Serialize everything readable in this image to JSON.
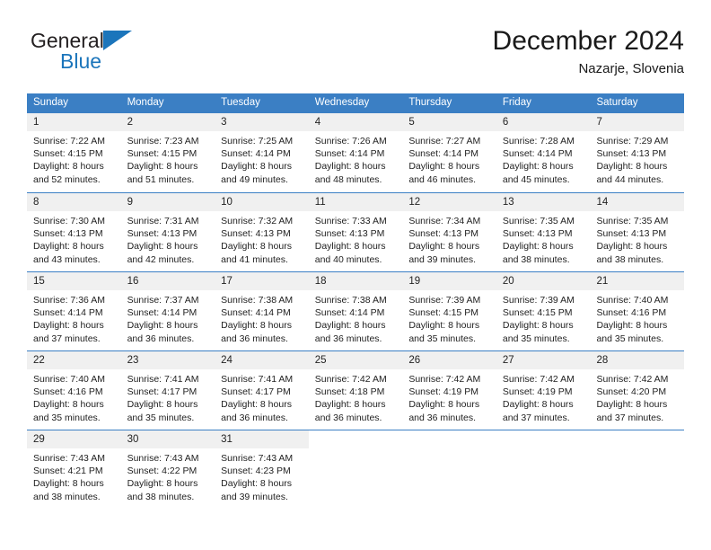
{
  "brand": {
    "name_top": "General",
    "name_bottom": "Blue",
    "triangle_color": "#1b75bb"
  },
  "header": {
    "title": "December 2024",
    "subtitle": "Nazarje, Slovenia"
  },
  "theme": {
    "header_blue": "#3b7fc4",
    "day_band_gray": "#f0f0f0",
    "text": "#222222"
  },
  "weekdays": [
    "Sunday",
    "Monday",
    "Tuesday",
    "Wednesday",
    "Thursday",
    "Friday",
    "Saturday"
  ],
  "labels": {
    "sunrise_prefix": "Sunrise:",
    "sunset_prefix": "Sunset:",
    "daylight_prefix": "Daylight:"
  },
  "weeks": [
    [
      {
        "day": "1",
        "sunrise": "Sunrise: 7:22 AM",
        "sunset": "Sunset: 4:15 PM",
        "daylight1": "Daylight: 8 hours",
        "daylight2": "and 52 minutes."
      },
      {
        "day": "2",
        "sunrise": "Sunrise: 7:23 AM",
        "sunset": "Sunset: 4:15 PM",
        "daylight1": "Daylight: 8 hours",
        "daylight2": "and 51 minutes."
      },
      {
        "day": "3",
        "sunrise": "Sunrise: 7:25 AM",
        "sunset": "Sunset: 4:14 PM",
        "daylight1": "Daylight: 8 hours",
        "daylight2": "and 49 minutes."
      },
      {
        "day": "4",
        "sunrise": "Sunrise: 7:26 AM",
        "sunset": "Sunset: 4:14 PM",
        "daylight1": "Daylight: 8 hours",
        "daylight2": "and 48 minutes."
      },
      {
        "day": "5",
        "sunrise": "Sunrise: 7:27 AM",
        "sunset": "Sunset: 4:14 PM",
        "daylight1": "Daylight: 8 hours",
        "daylight2": "and 46 minutes."
      },
      {
        "day": "6",
        "sunrise": "Sunrise: 7:28 AM",
        "sunset": "Sunset: 4:14 PM",
        "daylight1": "Daylight: 8 hours",
        "daylight2": "and 45 minutes."
      },
      {
        "day": "7",
        "sunrise": "Sunrise: 7:29 AM",
        "sunset": "Sunset: 4:13 PM",
        "daylight1": "Daylight: 8 hours",
        "daylight2": "and 44 minutes."
      }
    ],
    [
      {
        "day": "8",
        "sunrise": "Sunrise: 7:30 AM",
        "sunset": "Sunset: 4:13 PM",
        "daylight1": "Daylight: 8 hours",
        "daylight2": "and 43 minutes."
      },
      {
        "day": "9",
        "sunrise": "Sunrise: 7:31 AM",
        "sunset": "Sunset: 4:13 PM",
        "daylight1": "Daylight: 8 hours",
        "daylight2": "and 42 minutes."
      },
      {
        "day": "10",
        "sunrise": "Sunrise: 7:32 AM",
        "sunset": "Sunset: 4:13 PM",
        "daylight1": "Daylight: 8 hours",
        "daylight2": "and 41 minutes."
      },
      {
        "day": "11",
        "sunrise": "Sunrise: 7:33 AM",
        "sunset": "Sunset: 4:13 PM",
        "daylight1": "Daylight: 8 hours",
        "daylight2": "and 40 minutes."
      },
      {
        "day": "12",
        "sunrise": "Sunrise: 7:34 AM",
        "sunset": "Sunset: 4:13 PM",
        "daylight1": "Daylight: 8 hours",
        "daylight2": "and 39 minutes."
      },
      {
        "day": "13",
        "sunrise": "Sunrise: 7:35 AM",
        "sunset": "Sunset: 4:13 PM",
        "daylight1": "Daylight: 8 hours",
        "daylight2": "and 38 minutes."
      },
      {
        "day": "14",
        "sunrise": "Sunrise: 7:35 AM",
        "sunset": "Sunset: 4:13 PM",
        "daylight1": "Daylight: 8 hours",
        "daylight2": "and 38 minutes."
      }
    ],
    [
      {
        "day": "15",
        "sunrise": "Sunrise: 7:36 AM",
        "sunset": "Sunset: 4:14 PM",
        "daylight1": "Daylight: 8 hours",
        "daylight2": "and 37 minutes."
      },
      {
        "day": "16",
        "sunrise": "Sunrise: 7:37 AM",
        "sunset": "Sunset: 4:14 PM",
        "daylight1": "Daylight: 8 hours",
        "daylight2": "and 36 minutes."
      },
      {
        "day": "17",
        "sunrise": "Sunrise: 7:38 AM",
        "sunset": "Sunset: 4:14 PM",
        "daylight1": "Daylight: 8 hours",
        "daylight2": "and 36 minutes."
      },
      {
        "day": "18",
        "sunrise": "Sunrise: 7:38 AM",
        "sunset": "Sunset: 4:14 PM",
        "daylight1": "Daylight: 8 hours",
        "daylight2": "and 36 minutes."
      },
      {
        "day": "19",
        "sunrise": "Sunrise: 7:39 AM",
        "sunset": "Sunset: 4:15 PM",
        "daylight1": "Daylight: 8 hours",
        "daylight2": "and 35 minutes."
      },
      {
        "day": "20",
        "sunrise": "Sunrise: 7:39 AM",
        "sunset": "Sunset: 4:15 PM",
        "daylight1": "Daylight: 8 hours",
        "daylight2": "and 35 minutes."
      },
      {
        "day": "21",
        "sunrise": "Sunrise: 7:40 AM",
        "sunset": "Sunset: 4:16 PM",
        "daylight1": "Daylight: 8 hours",
        "daylight2": "and 35 minutes."
      }
    ],
    [
      {
        "day": "22",
        "sunrise": "Sunrise: 7:40 AM",
        "sunset": "Sunset: 4:16 PM",
        "daylight1": "Daylight: 8 hours",
        "daylight2": "and 35 minutes."
      },
      {
        "day": "23",
        "sunrise": "Sunrise: 7:41 AM",
        "sunset": "Sunset: 4:17 PM",
        "daylight1": "Daylight: 8 hours",
        "daylight2": "and 35 minutes."
      },
      {
        "day": "24",
        "sunrise": "Sunrise: 7:41 AM",
        "sunset": "Sunset: 4:17 PM",
        "daylight1": "Daylight: 8 hours",
        "daylight2": "and 36 minutes."
      },
      {
        "day": "25",
        "sunrise": "Sunrise: 7:42 AM",
        "sunset": "Sunset: 4:18 PM",
        "daylight1": "Daylight: 8 hours",
        "daylight2": "and 36 minutes."
      },
      {
        "day": "26",
        "sunrise": "Sunrise: 7:42 AM",
        "sunset": "Sunset: 4:19 PM",
        "daylight1": "Daylight: 8 hours",
        "daylight2": "and 36 minutes."
      },
      {
        "day": "27",
        "sunrise": "Sunrise: 7:42 AM",
        "sunset": "Sunset: 4:19 PM",
        "daylight1": "Daylight: 8 hours",
        "daylight2": "and 37 minutes."
      },
      {
        "day": "28",
        "sunrise": "Sunrise: 7:42 AM",
        "sunset": "Sunset: 4:20 PM",
        "daylight1": "Daylight: 8 hours",
        "daylight2": "and 37 minutes."
      }
    ],
    [
      {
        "day": "29",
        "sunrise": "Sunrise: 7:43 AM",
        "sunset": "Sunset: 4:21 PM",
        "daylight1": "Daylight: 8 hours",
        "daylight2": "and 38 minutes."
      },
      {
        "day": "30",
        "sunrise": "Sunrise: 7:43 AM",
        "sunset": "Sunset: 4:22 PM",
        "daylight1": "Daylight: 8 hours",
        "daylight2": "and 38 minutes."
      },
      {
        "day": "31",
        "sunrise": "Sunrise: 7:43 AM",
        "sunset": "Sunset: 4:23 PM",
        "daylight1": "Daylight: 8 hours",
        "daylight2": "and 39 minutes."
      },
      {
        "day": "",
        "sunrise": "",
        "sunset": "",
        "daylight1": "",
        "daylight2": ""
      },
      {
        "day": "",
        "sunrise": "",
        "sunset": "",
        "daylight1": "",
        "daylight2": ""
      },
      {
        "day": "",
        "sunrise": "",
        "sunset": "",
        "daylight1": "",
        "daylight2": ""
      },
      {
        "day": "",
        "sunrise": "",
        "sunset": "",
        "daylight1": "",
        "daylight2": ""
      }
    ]
  ]
}
